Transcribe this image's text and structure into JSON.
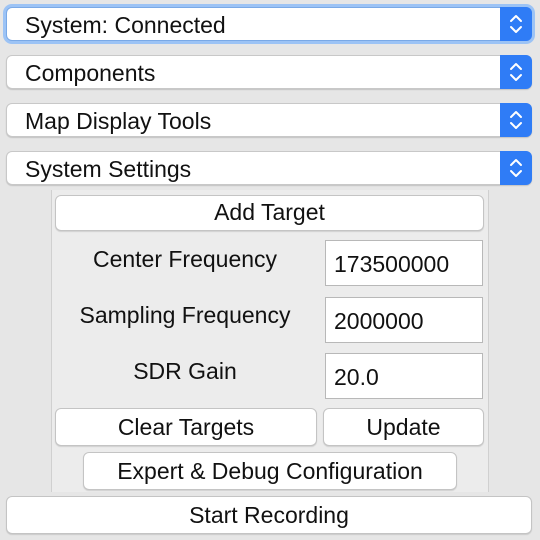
{
  "dropdowns": [
    {
      "label": "System: Connected"
    },
    {
      "label": "Components"
    },
    {
      "label": "Map Display Tools"
    },
    {
      "label": "System Settings"
    }
  ],
  "settings": {
    "add_target_label": "Add Target",
    "center_frequency": {
      "label": "Center Frequency",
      "value": "173500000"
    },
    "sampling_frequency": {
      "label": "Sampling Frequency",
      "value": "2000000"
    },
    "sdr_gain": {
      "label": "SDR Gain",
      "value": "20.0"
    },
    "clear_targets_label": "Clear Targets",
    "update_label": "Update",
    "expert_debug_label": "Expert & Debug Configuration"
  },
  "start_recording_label": "Start Recording",
  "colors": {
    "accent": "#2f7cf6",
    "background": "#e6e6e6"
  },
  "icons": {
    "stepper": "chevron-up-down-icon"
  }
}
